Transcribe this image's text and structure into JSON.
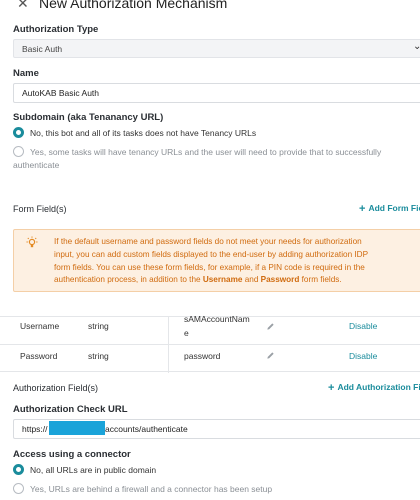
{
  "header": {
    "close_glyph": "✕",
    "title": "New Authorization Mechanism"
  },
  "auth_type": {
    "label": "Authorization Type",
    "value": "Basic Auth"
  },
  "name": {
    "label": "Name",
    "value": "AutoKAB Basic Auth"
  },
  "subdomain": {
    "label": "Subdomain (aka Tenanancy URL)",
    "option_no": "No, this bot and all of its tasks does not have Tenancy URLs",
    "option_yes_line1": "Yes, some tasks will have tenancy URLs and the user will need to provide that to successfully",
    "option_yes_line2": "authenticate"
  },
  "form_fields": {
    "label": "Form Field(s)",
    "add_label": "Add Form Fie",
    "notice": {
      "line1": "If the default username and password fields do not meet your needs for authorization",
      "line2": "input, you can add custom fields displayed to the end-user by adding authorization IDP",
      "line3": "form fields. You can use these form fields, for example, if a PIN code is required in the",
      "line4_pre": "authentication process, in addition to the ",
      "line4_b1": "Username",
      "line4_mid": " and ",
      "line4_b2": "Password",
      "line4_post": " form fields."
    },
    "rows": [
      {
        "name": "Username",
        "type": "string",
        "key_line1": "sAMAccountNam",
        "key_line2": "e",
        "action": "Disable"
      },
      {
        "name": "Password",
        "type": "string",
        "key_line1": "password",
        "key_line2": "",
        "action": "Disable"
      }
    ]
  },
  "auth_fields": {
    "label": "Authorization Field(s)",
    "add_label": "Add Authorization Fie"
  },
  "check_url": {
    "label": "Authorization Check URL",
    "prefix": "https://",
    "suffix": "accounts/authenticate"
  },
  "connector": {
    "label": "Access using a connector",
    "option_no": "No, all URLs are in public domain",
    "option_yes": "Yes, URLs are behind a firewall and a connector has been setup"
  },
  "colors": {
    "accent": "#1a8c9c",
    "notice_text": "#d06b0f",
    "notice_bg": "#fdf0e2",
    "redaction": "#1aa3d9"
  }
}
